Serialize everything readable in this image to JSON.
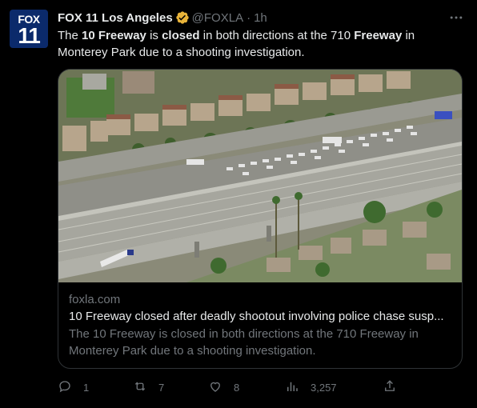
{
  "tweet": {
    "avatar": {
      "line1": "FOX",
      "line2": "11",
      "bg": "#0b2a6b"
    },
    "author_name": "FOX 11 Los Angeles",
    "handle": "@FOXLA",
    "separator": "·",
    "time": "1h",
    "verified_icon": "verified-badge-icon",
    "text": {
      "p1": "The ",
      "b1": "10 Freeway",
      "p2": " is ",
      "b2": "closed",
      "p3": " in both directions at the 710 ",
      "b3": "Freeway",
      "p4": " in Monterey Park due to a shooting investigation."
    },
    "card": {
      "domain": "foxla.com",
      "title": "10 Freeway closed after deadly shootout involving police chase susp...",
      "description": "The 10 Freeway is closed in both directions at the 710 Freeway in Monterey Park due to a shooting investigation."
    },
    "actions": {
      "replies": "1",
      "retweets": "7",
      "likes": "8",
      "views": "3,257"
    }
  },
  "colors": {
    "background": "#000000",
    "text": "#e7e9ea",
    "secondary": "#71767b",
    "border": "#2f3336",
    "verified": "#e8b339"
  }
}
